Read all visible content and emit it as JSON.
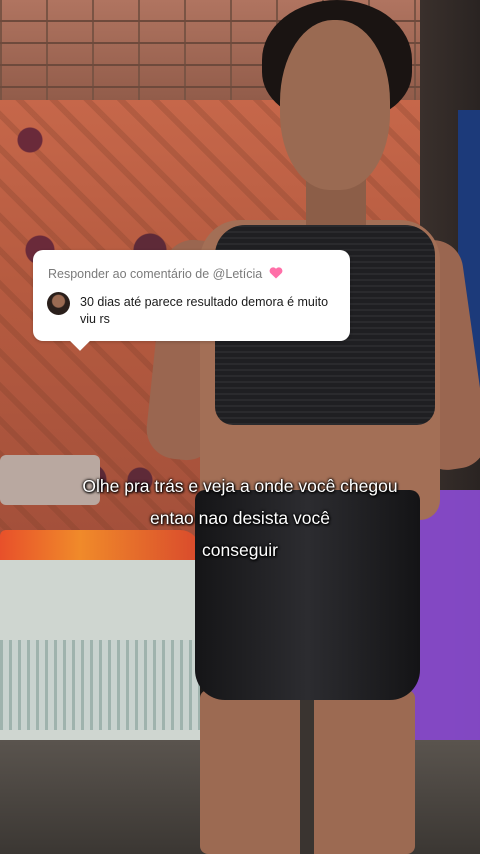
{
  "reply": {
    "header": "Responder ao comentário de @Letícia",
    "heart_icon": "pink-heart-icon",
    "comment_text": "30 dias até parece resultado demora é muito viu rs"
  },
  "caption": {
    "line1": "Olhe pra trás e veja a onde você chegou",
    "line2": "entao nao desista você",
    "line3": "conseguir"
  },
  "colors": {
    "heart": "#ff6fa8",
    "card_bg": "#ffffff",
    "caption_text": "#ffffff"
  }
}
